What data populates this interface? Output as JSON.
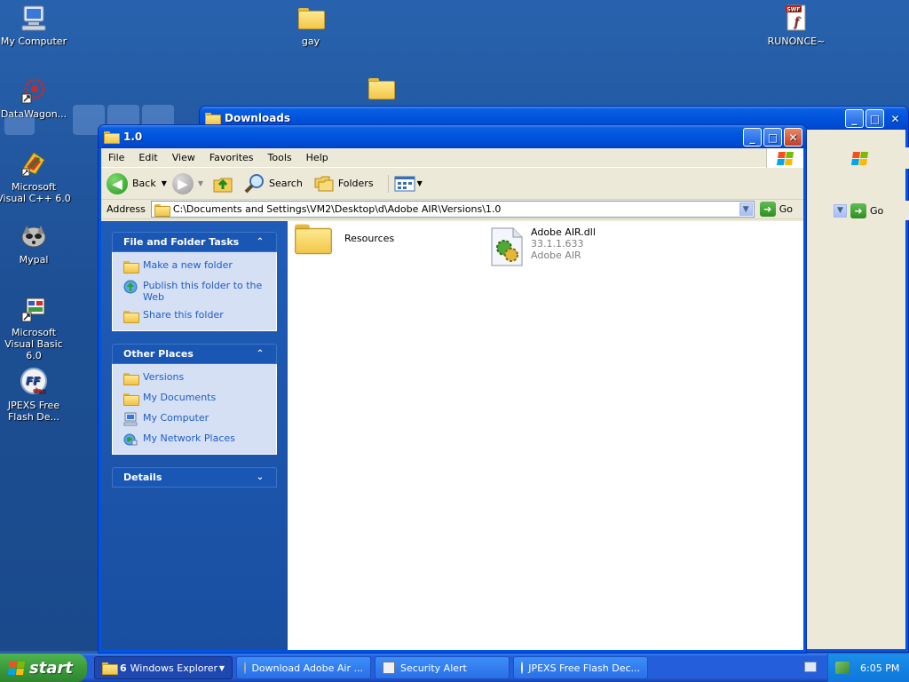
{
  "desktop": {
    "icons": [
      {
        "label": "My Computer",
        "icon": "my-computer-icon"
      },
      {
        "label": "gay",
        "icon": "folder-icon"
      },
      {
        "label": "RUNONCE~",
        "icon": "swf-file-icon",
        "badge": "SWF"
      },
      {
        "label": "DataWagon...",
        "icon": "datawagon-icon"
      },
      {
        "label": "Microsoft Visual C++ 6.0",
        "icon": "visual-cpp-icon"
      },
      {
        "label": "Mypal",
        "icon": "mypal-icon"
      },
      {
        "label": "Microsoft Visual Basic 6.0",
        "icon": "visual-basic-icon"
      },
      {
        "label": "JPEXS Free Flash De...",
        "icon": "jpexs-icon",
        "badge": "FF"
      }
    ]
  },
  "back_window": {
    "title": "Downloads",
    "go_label": "Go"
  },
  "window": {
    "title": "1.0",
    "menu": [
      "File",
      "Edit",
      "View",
      "Favorites",
      "Tools",
      "Help"
    ],
    "toolbar": {
      "back": "Back",
      "search": "Search",
      "folders": "Folders"
    },
    "address": {
      "label": "Address",
      "value": "C:\\Documents and Settings\\VM2\\Desktop\\d\\Adobe AIR\\Versions\\1.0",
      "go": "Go"
    },
    "tasks": {
      "title": "File and Folder Tasks",
      "items": [
        "Make a new folder",
        "Publish this folder to the Web",
        "Share this folder"
      ]
    },
    "places": {
      "title": "Other Places",
      "items": [
        "Versions",
        "My Documents",
        "My Computer",
        "My Network Places"
      ]
    },
    "details": {
      "title": "Details"
    },
    "files": [
      {
        "name": "Resources",
        "type": "folder"
      },
      {
        "name": "Adobe AIR.dll",
        "version": "33.1.1.633",
        "company": "Adobe AIR",
        "type": "dll"
      }
    ]
  },
  "taskbar": {
    "start": "start",
    "items": [
      {
        "count": "6",
        "label": "Windows Explorer"
      },
      {
        "label": "Download Adobe Air ..."
      },
      {
        "label": "Security Alert"
      },
      {
        "label": "JPEXS Free Flash Dec..."
      }
    ],
    "clock": "6:05 PM"
  },
  "colors": {
    "accent": "#0054e3",
    "pane_link": "#215dc6",
    "desktop": "#1d4f94"
  }
}
